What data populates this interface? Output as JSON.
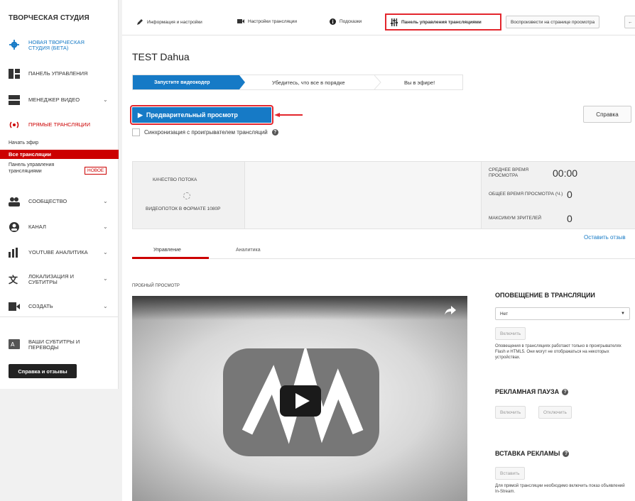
{
  "sidebar": {
    "title": "ТВОРЧЕСКАЯ СТУДИЯ",
    "items": [
      {
        "label": "НОВАЯ ТВОРЧЕСКАЯ СТУДИЯ (БЕТА)",
        "icon": "gear-icon"
      },
      {
        "label": "ПАНЕЛЬ УПРАВЛЕНИЯ",
        "icon": "dashboard-icon"
      },
      {
        "label": "МЕНЕДЖЕР ВИДЕО",
        "icon": "video-manager-icon"
      },
      {
        "label": "ПРЯМЫЕ ТРАНСЛЯЦИИ",
        "icon": "live-broadcast-icon"
      },
      {
        "label": "СООБЩЕСТВО",
        "icon": "community-icon"
      },
      {
        "label": "КАНАЛ",
        "icon": "channel-icon"
      },
      {
        "label": "YOUTUBE АНАЛИТИКА",
        "icon": "analytics-icon"
      },
      {
        "label": "ЛОКАЛИЗАЦИЯ И СУБТИТРЫ",
        "icon": "translate-icon"
      },
      {
        "label": "СОЗДАТЬ",
        "icon": "create-icon"
      },
      {
        "label": "ВАШИ СУБТИТРЫ И ПЕРЕВОДЫ",
        "icon": "subtitles-icon"
      }
    ],
    "sub_start": "Начать эфир",
    "sub_all": "Все трансляции",
    "sub_dashboard": "Панель управления трансляциями",
    "badge_new": "НОВОЕ",
    "help_button": "Справка и отзывы",
    "accent_color": "#cc0000"
  },
  "topnav": {
    "info": "Информация и настройки",
    "stream_settings": "Настройки трансляции",
    "tips": "Подсказки",
    "live_dashboard": "Панель управления трансляциями",
    "play_on_watch": "Воспроизвести на странице просмотра",
    "back_arrow": "←"
  },
  "page": {
    "title": "TEST Dahua",
    "step1": "Запустите видеокодер",
    "step2": "Убедитесь, что все в порядке",
    "step3": "Вы в эфире!",
    "preview_button": "Предварительный просмотр",
    "help_button": "Справка",
    "sync_label": "Синхронизация с проигрывателем трансляций",
    "feedback": "Оставить отзыв"
  },
  "stats": {
    "quality_label": "КАЧЕСТВО ПОТОКА",
    "quality_note": "ВИДЕОПОТОК В ФОРМАТЕ 1080P",
    "avg_watch_label": "СРЕДНЕЕ ВРЕМЯ ПРОСМОТРА",
    "avg_watch_value": "00:00",
    "total_watch_label": "ОБЩЕЕ ВРЕМЯ ПРОСМОТРА (Ч.)",
    "total_watch_value": "0",
    "max_viewers_label": "МАКСИМУМ ЗРИТЕЛЕЙ",
    "max_viewers_value": "0"
  },
  "tabs": {
    "manage": "Управление",
    "analytics": "Аналитика"
  },
  "preview": {
    "label": "ПРОБНЫЙ ПРОСМОТР"
  },
  "right": {
    "alert_title": "ОПОВЕЩЕНИЕ В ТРАНСЛЯЦИИ",
    "alert_select": "Нет",
    "alert_enable": "Включить",
    "alert_note": "Оповещения в трансляциях работают только в проигрывателях Flash и HTML5. Они могут не отображаться на некоторых устройствах.",
    "pause_title": "РЕКЛАМНАЯ ПАУЗА",
    "pause_on": "Включить",
    "pause_off": "Отключить",
    "insert_title": "ВСТАВКА РЕКЛАМЫ",
    "insert_btn": "Вставить",
    "insert_note": "Для прямой трансляции необходимо включить показ объявлений In-Stream."
  }
}
